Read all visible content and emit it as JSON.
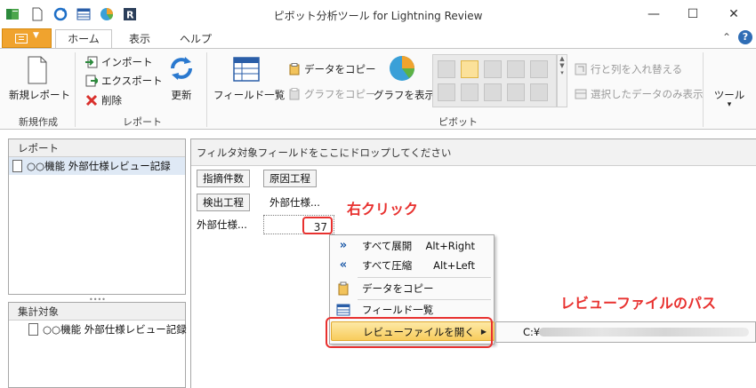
{
  "window": {
    "title": "ピボット分析ツール for Lightning Review",
    "minimize": "—",
    "maximize": "☐",
    "close": "✕"
  },
  "tabs": {
    "home": "ホーム",
    "view": "表示",
    "help": "ヘルプ",
    "right_caret": "⌃",
    "help_icon": "?"
  },
  "ribbon": {
    "new_report": "新規レポート",
    "group_new": "新規作成",
    "import": "インポート",
    "export": "エクスポート",
    "delete": "削除",
    "group_report": "レポート",
    "refresh": "更新",
    "field_list": "フィールド一覧",
    "copy_data": "データをコピー",
    "copy_graph": "グラフをコピー",
    "show_graph": "グラフを表示",
    "swap_rows_cols": "行と列を入れ替える",
    "show_selected_only": "選択したデータのみ表示",
    "group_pivot": "ピボット",
    "tools": "ツール",
    "tools_caret": "▾"
  },
  "report_panel": {
    "header": "レポート",
    "items": [
      "○○機能 外部仕様レビュー記録"
    ]
  },
  "target_panel": {
    "header": "集計対象",
    "items": [
      "○○機能 外部仕様レビュー記録"
    ]
  },
  "pivot": {
    "filter_drop_text": "フィルタ対象フィールドをここにドロップしてください",
    "column_fields": [
      "指摘件数",
      "原因工程"
    ],
    "row_field": "検出工程",
    "column_header_value": "外部仕様...",
    "row_header_value": "外部仕様...",
    "cell_value": "37"
  },
  "context_menu": {
    "items": [
      {
        "label": "すべて展開",
        "shortcut": "Alt+Right",
        "icon": "expand-all-icon"
      },
      {
        "label": "すべて圧縮",
        "shortcut": "Alt+Left",
        "icon": "collapse-all-icon"
      },
      {
        "label": "データをコピー",
        "shortcut": "",
        "icon": "copy-data-icon"
      },
      {
        "label": "フィールド一覧",
        "shortcut": "",
        "icon": "field-list-icon"
      },
      {
        "label": "レビューファイルを開く",
        "shortcut": "",
        "icon": ""
      }
    ],
    "submenu_path": "C:¥"
  },
  "annotations": {
    "right_click": "右クリック",
    "review_file_path": "レビューファイルのパス"
  },
  "colors": {
    "accent_orange": "#f0a32e",
    "annotation_red": "#e8312f",
    "menu_hover": "#f8cc5c"
  }
}
